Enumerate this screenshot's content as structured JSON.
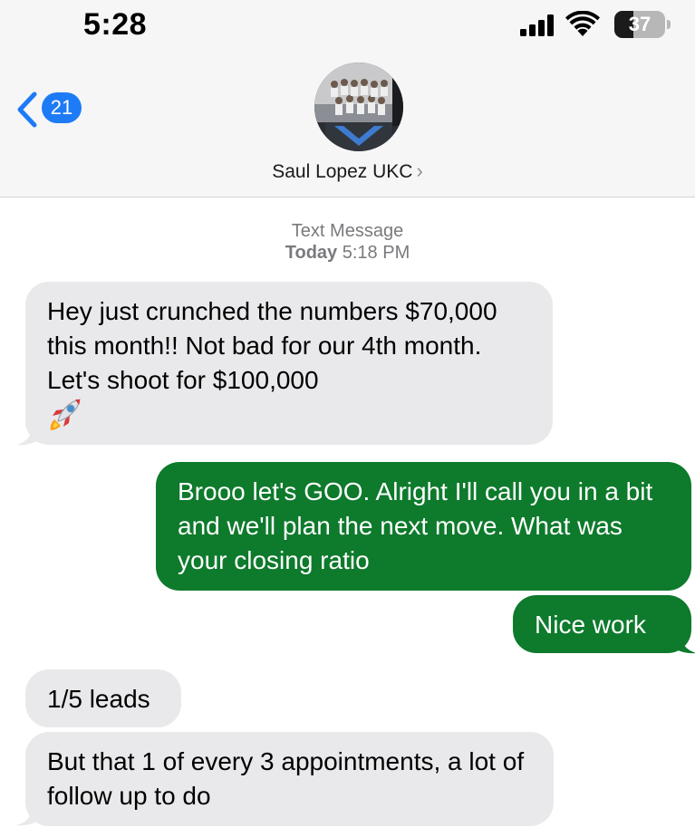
{
  "status_bar": {
    "time": "5:28",
    "battery_level": "37",
    "battery_fraction": 0.37
  },
  "header": {
    "back_badge_count": "21",
    "contact_name": "Saul Lopez UKC",
    "contact_chevron": "›"
  },
  "conversation": {
    "meta_label": "Text Message",
    "meta_day": "Today",
    "meta_time": "5:18 PM",
    "messages": [
      {
        "direction": "incoming",
        "text": "Hey just crunched the numbers $70,000 this month!! Not bad for our 4th month. Let's shoot for $100,000",
        "emoji": "rocket-emoji"
      },
      {
        "direction": "outgoing",
        "text": "Brooo let's GOO. Alright I'll call you in a bit and we'll plan the next move. What was your closing ratio"
      },
      {
        "direction": "outgoing",
        "text": "Nice work"
      },
      {
        "direction": "incoming",
        "text": "1/5 leads"
      },
      {
        "direction": "incoming",
        "text": "But that 1 of every 3 appointments, a lot of follow up to do"
      }
    ]
  },
  "colors": {
    "incoming_bubble": "#e9e9eb",
    "outgoing_bubble": "#0e7a2c",
    "badge_blue": "#1e7bf6",
    "header_bg": "#f6f6f6"
  }
}
